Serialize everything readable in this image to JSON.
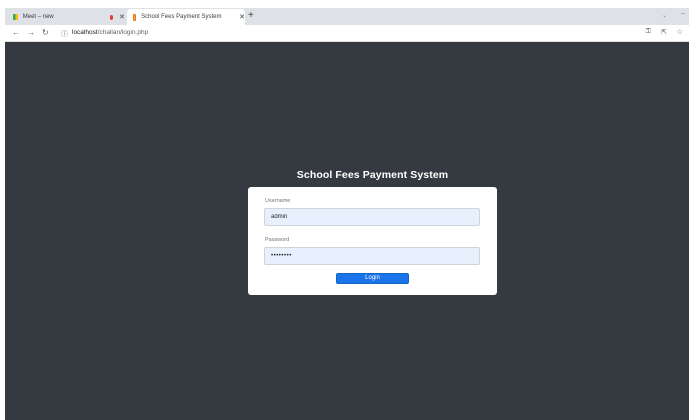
{
  "browser": {
    "tabs": [
      {
        "title": "Meet – new",
        "active": false,
        "recording": true
      },
      {
        "title": "School Fees Payment System",
        "active": true
      }
    ],
    "new_tab_glyph": "+",
    "address_bar": {
      "host": "localhost",
      "path": "/challan/login.php"
    },
    "icons": {
      "back": "back-arrow-icon",
      "forward": "forward-arrow-icon",
      "reload": "reload-icon",
      "site_info": "site-info-icon",
      "key": "key-icon",
      "share": "share-icon",
      "star": "star-icon"
    }
  },
  "page": {
    "title": "School Fees Payment System",
    "form": {
      "username_label": "Username",
      "username_value": "admin",
      "password_label": "Password",
      "password_value": "••••••••",
      "login_label": "Login"
    },
    "colors": {
      "background": "#343a40",
      "card": "#ffffff",
      "input_fill": "#e8f0fe",
      "button": "#1a73e8"
    }
  }
}
